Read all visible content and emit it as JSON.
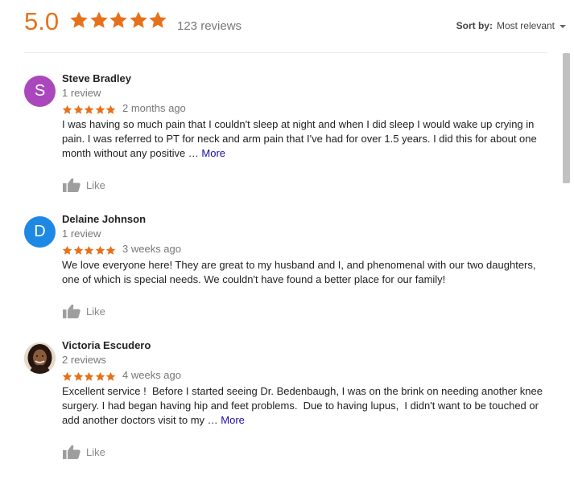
{
  "summary": {
    "rating": "5.0",
    "stars": 5,
    "review_count": "123 reviews"
  },
  "sort": {
    "label": "Sort by:",
    "value": "Most relevant"
  },
  "colors": {
    "star": "#e7711b",
    "link": "#1a0dab",
    "avatar_steve": "#ab47bc",
    "avatar_delaine": "#1e88e5"
  },
  "reviews": [
    {
      "name": "Steve Bradley",
      "initial": "S",
      "count": "1 review",
      "stars": 5,
      "date": "2 months ago",
      "text": "I was having so much pain that I couldn't sleep at night and when I did sleep I would wake up crying in pain. I was referred to PT for neck and arm pain that I've had for over 1.5 years. I did this for about one month without any positive … ",
      "more": "More",
      "like": "Like"
    },
    {
      "name": "Delaine Johnson",
      "initial": "D",
      "count": "1 review",
      "stars": 5,
      "date": "3 weeks ago",
      "text": "We love everyone here! They are great to my husband and I, and phenomenal with our two daughters, one of which is special needs. We couldn't have found a better place for our family!",
      "like": "Like"
    },
    {
      "name": "Victoria Escudero",
      "count": "2 reviews",
      "stars": 5,
      "date": "4 weeks ago",
      "text": "Excellent service !  Before I started seeing Dr. Bedenbaugh, I was on the brink on needing another knee surgery. I had began having hip and feet problems.  Due to having lupus,  I didn't want to be touched or add another doctors visit to my … ",
      "more": "More",
      "like": "Like"
    }
  ]
}
